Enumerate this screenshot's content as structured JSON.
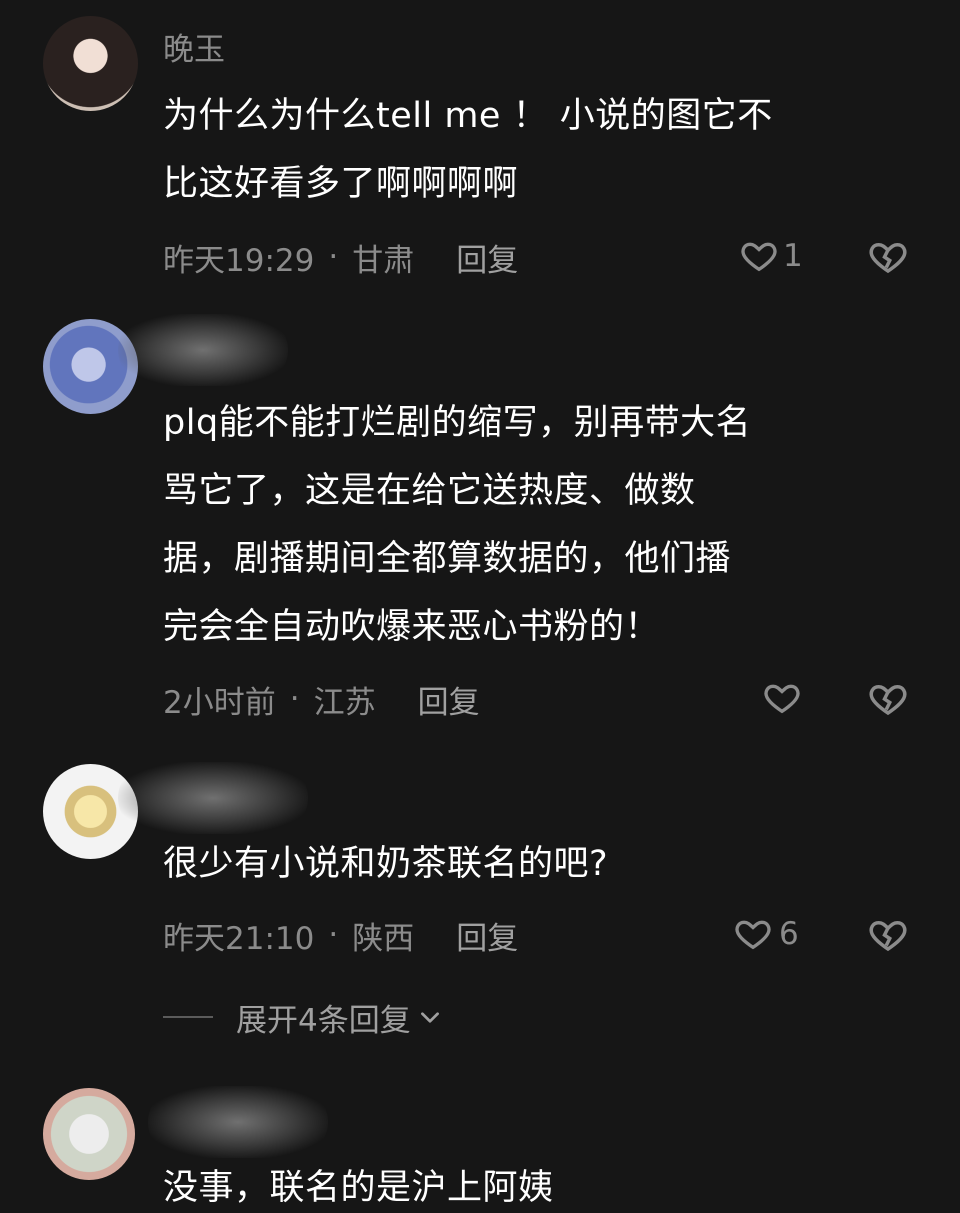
{
  "comments": [
    {
      "name": "晚玉",
      "text": "为什么为什么tell me ！ 小说的图它不\n比这好看多了啊啊啊啊",
      "time": "昨天19:29",
      "location": "甘肃",
      "reply": "回复",
      "likes": "1"
    },
    {
      "name": "",
      "text": "plq能不能打烂剧的缩写，别再带大名\n骂它了，这是在给它送热度、做数\n据，剧播期间全都算数据的，他们播\n完会全自动吹爆来恶心书粉的！",
      "time": "2小时前",
      "location": "江苏",
      "reply": "回复",
      "likes": ""
    },
    {
      "name": "",
      "text": "很少有小说和奶茶联名的吧?",
      "time": "昨天21:10",
      "location": "陕西",
      "reply": "回复",
      "likes": "6"
    },
    {
      "name": "",
      "text": "没事，联名的是沪上阿姨",
      "time": "",
      "location": "",
      "reply": "",
      "likes": ""
    }
  ],
  "separator": "·",
  "expand_replies": "展开4条回复",
  "icons": {
    "like": "heart-outline-icon",
    "dislike": "broken-heart-icon",
    "expand": "chevron-down-icon"
  },
  "colors": {
    "background": "#161616",
    "primary_text": "#ffffff",
    "secondary_text": "#8b8b8b"
  }
}
